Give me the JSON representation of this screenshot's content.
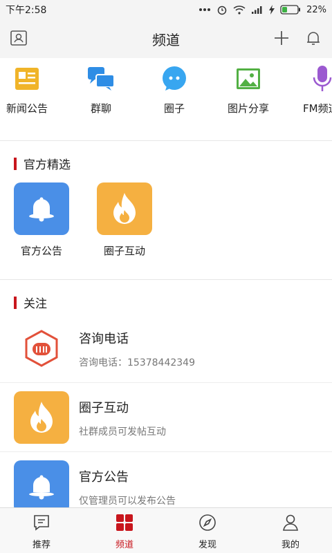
{
  "status_bar": {
    "time": "下午2:58",
    "battery": "22%"
  },
  "header": {
    "title": "频道"
  },
  "channels": [
    {
      "label": "新闻公告",
      "icon": "news-icon"
    },
    {
      "label": "群聊",
      "icon": "group-chat-icon"
    },
    {
      "label": "圈子",
      "icon": "circle-chat-icon"
    },
    {
      "label": "图片分享",
      "icon": "image-icon"
    },
    {
      "label": "FM频道",
      "icon": "microphone-icon"
    }
  ],
  "featured": {
    "title": "官方精选",
    "items": [
      {
        "label": "官方公告",
        "icon": "bell-icon"
      },
      {
        "label": "圈子互动",
        "icon": "flame-icon"
      }
    ]
  },
  "follow": {
    "title": "关注",
    "items": [
      {
        "name": "咨询电话",
        "desc": "咨询电话：15378442349",
        "icon": "hexagon-logo-icon"
      },
      {
        "name": "圈子互动",
        "desc": "社群成员可发帖互动",
        "icon": "flame-icon"
      },
      {
        "name": "官方公告",
        "desc": "仅管理员可以发布公告",
        "icon": "bell-icon"
      }
    ]
  },
  "tabs": [
    {
      "label": "推荐",
      "icon": "recommend-icon"
    },
    {
      "label": "频道",
      "icon": "channel-grid-icon",
      "active": true
    },
    {
      "label": "发现",
      "icon": "compass-icon"
    },
    {
      "label": "我的",
      "icon": "profile-icon"
    }
  ],
  "colors": {
    "accent": "#c8161d",
    "blue_tile": "#4a8fe7",
    "orange_tile": "#f5b041"
  }
}
